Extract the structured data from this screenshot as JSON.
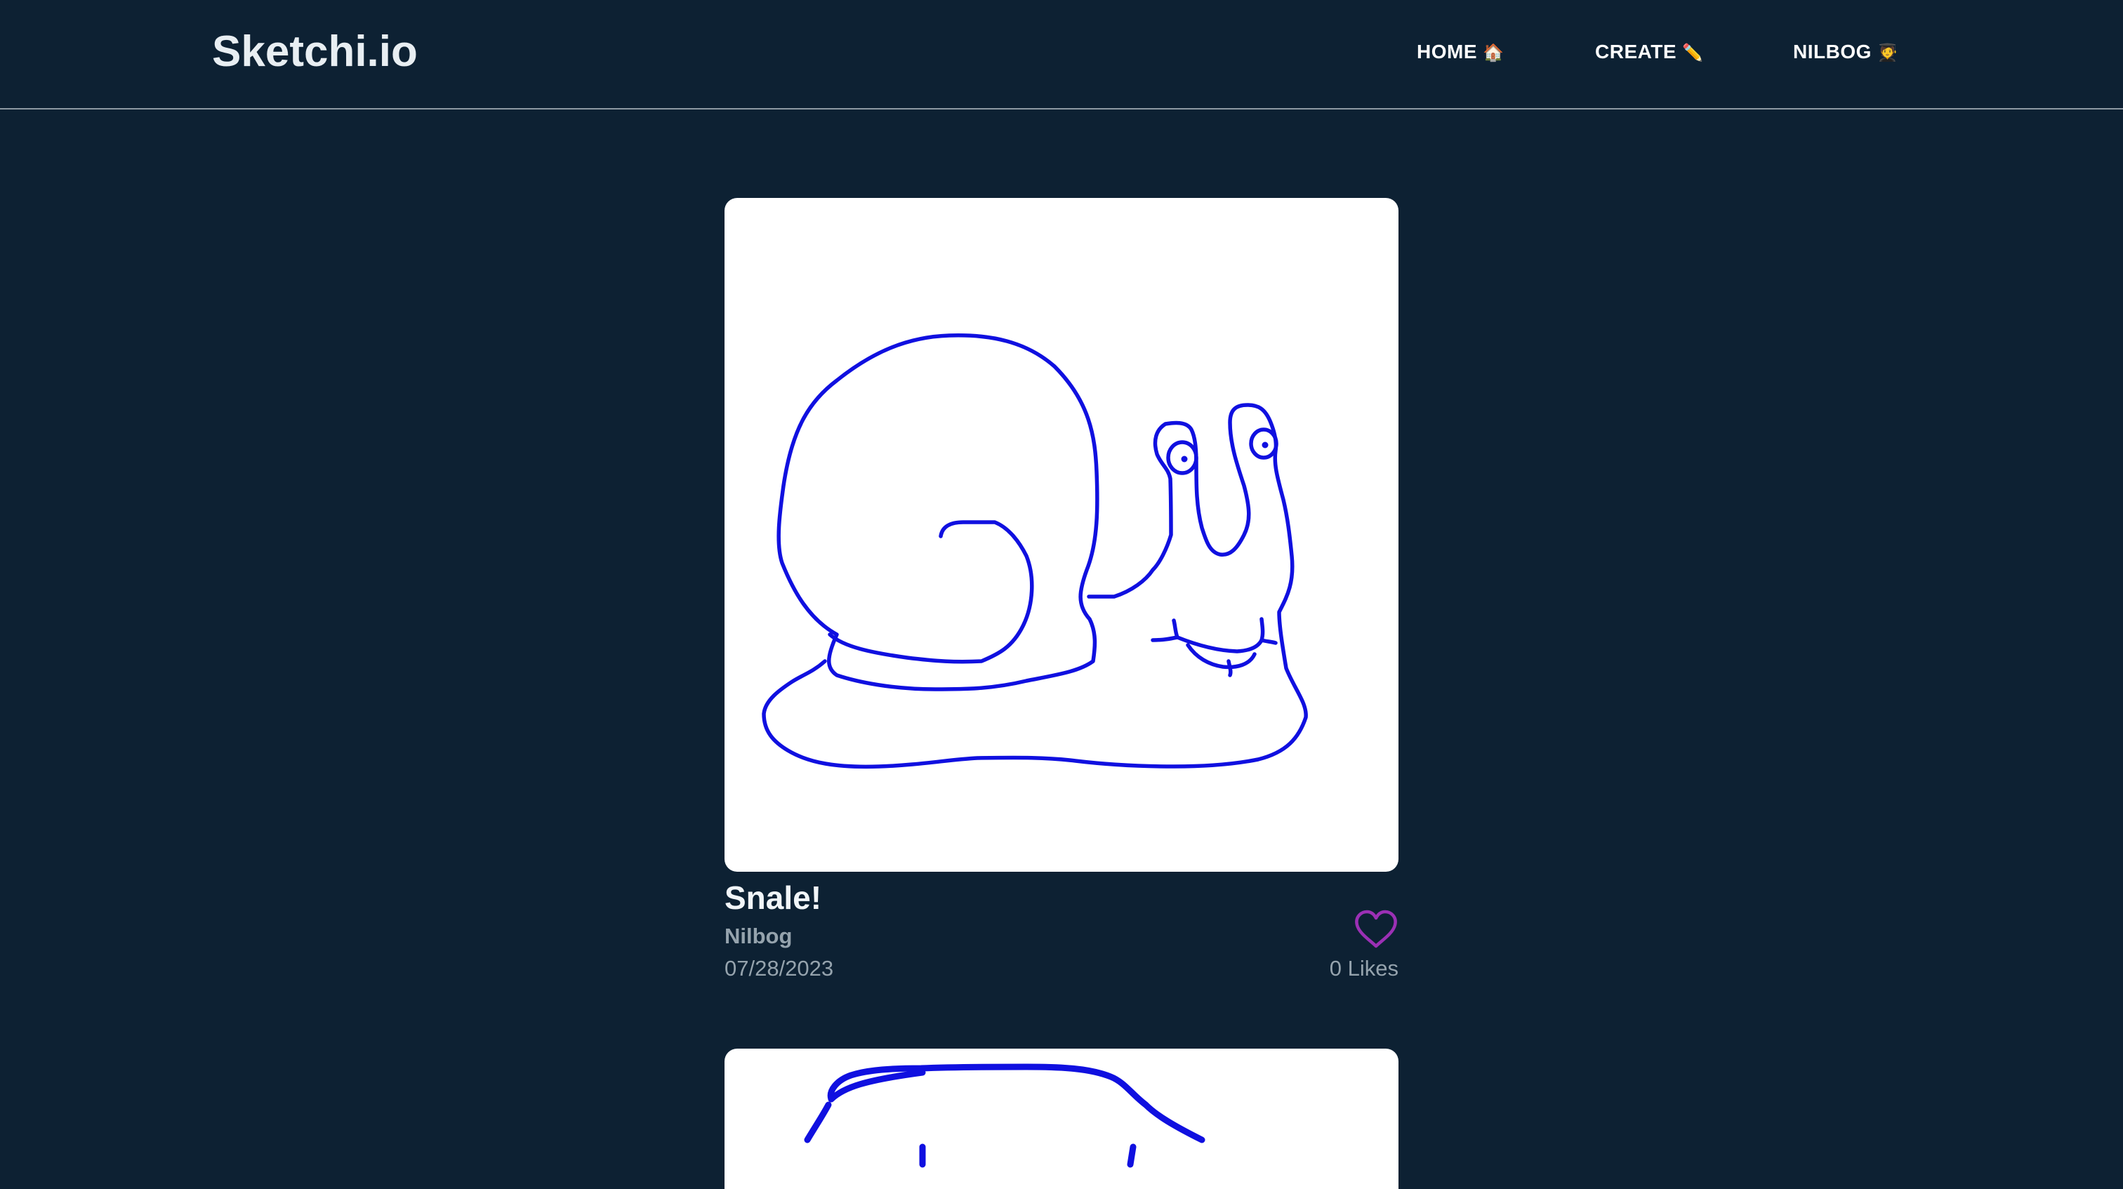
{
  "header": {
    "brand": "Sketchi.io",
    "nav": {
      "home_label": "HOME",
      "home_icon": "🏠",
      "create_label": "CREATE",
      "create_icon": "✏️",
      "user_label": "NILBOG",
      "user_icon": "🧑‍🎓"
    }
  },
  "feed": {
    "posts": [
      {
        "title": "Snale!",
        "author": "Nilbog",
        "date": "07/28/2023",
        "likes": "0 Likes",
        "sketch_subject": "snail drawing",
        "stroke_color": "#1010e0"
      }
    ]
  },
  "colors": {
    "background": "#0d2133",
    "heart": "#9b30b5",
    "muted_text": "#95a3ad"
  }
}
